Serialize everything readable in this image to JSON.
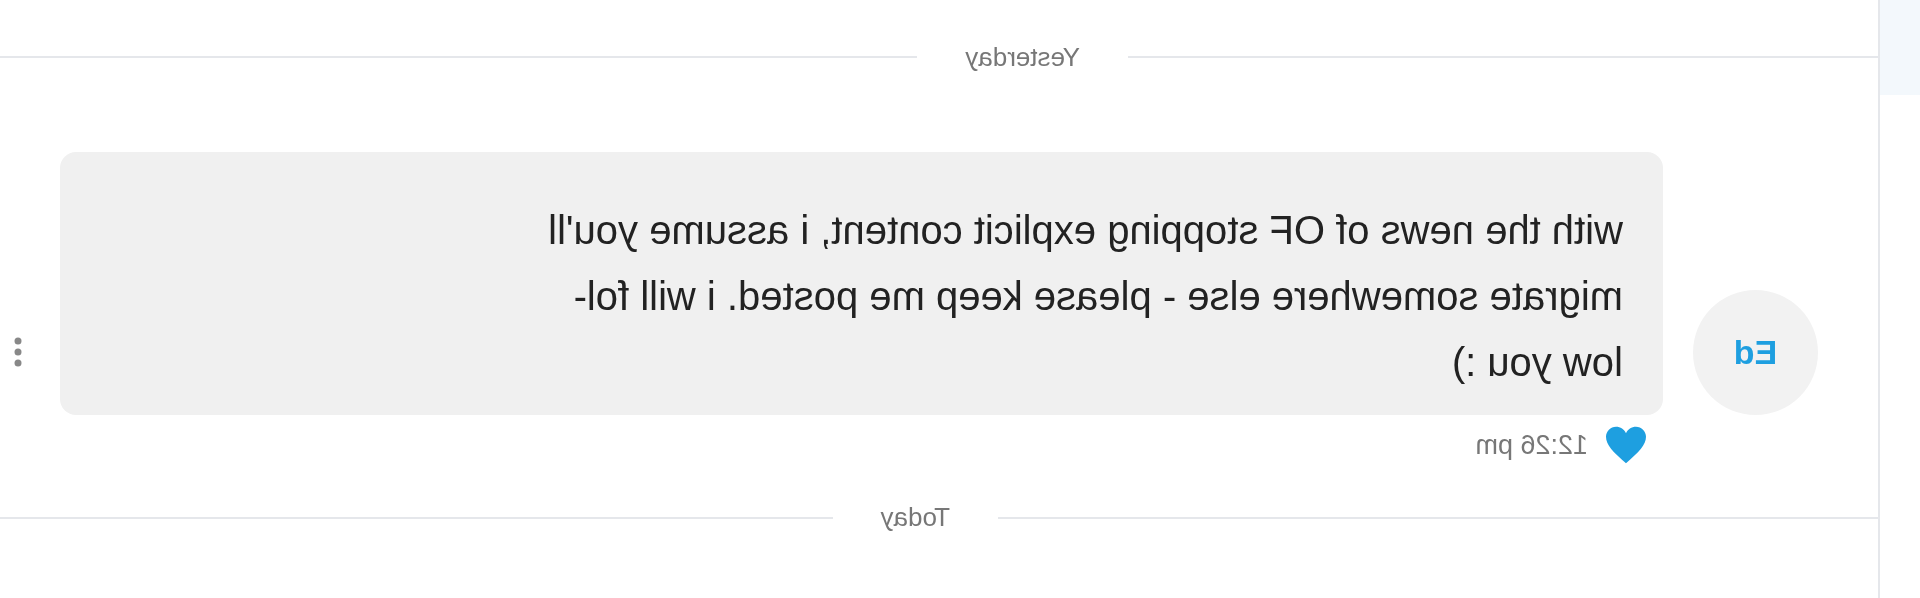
{
  "dividers": [
    {
      "label": "Yesterday"
    },
    {
      "label": "Today"
    }
  ],
  "message": {
    "sender_initials": "Ed",
    "lines": [
      "with the news of OF stopping explicit content, i assume you'll",
      "migrate somewhere else - please keep me posted. i will fol-",
      "low you :)"
    ],
    "time": "12:26 pm",
    "liked": true
  }
}
